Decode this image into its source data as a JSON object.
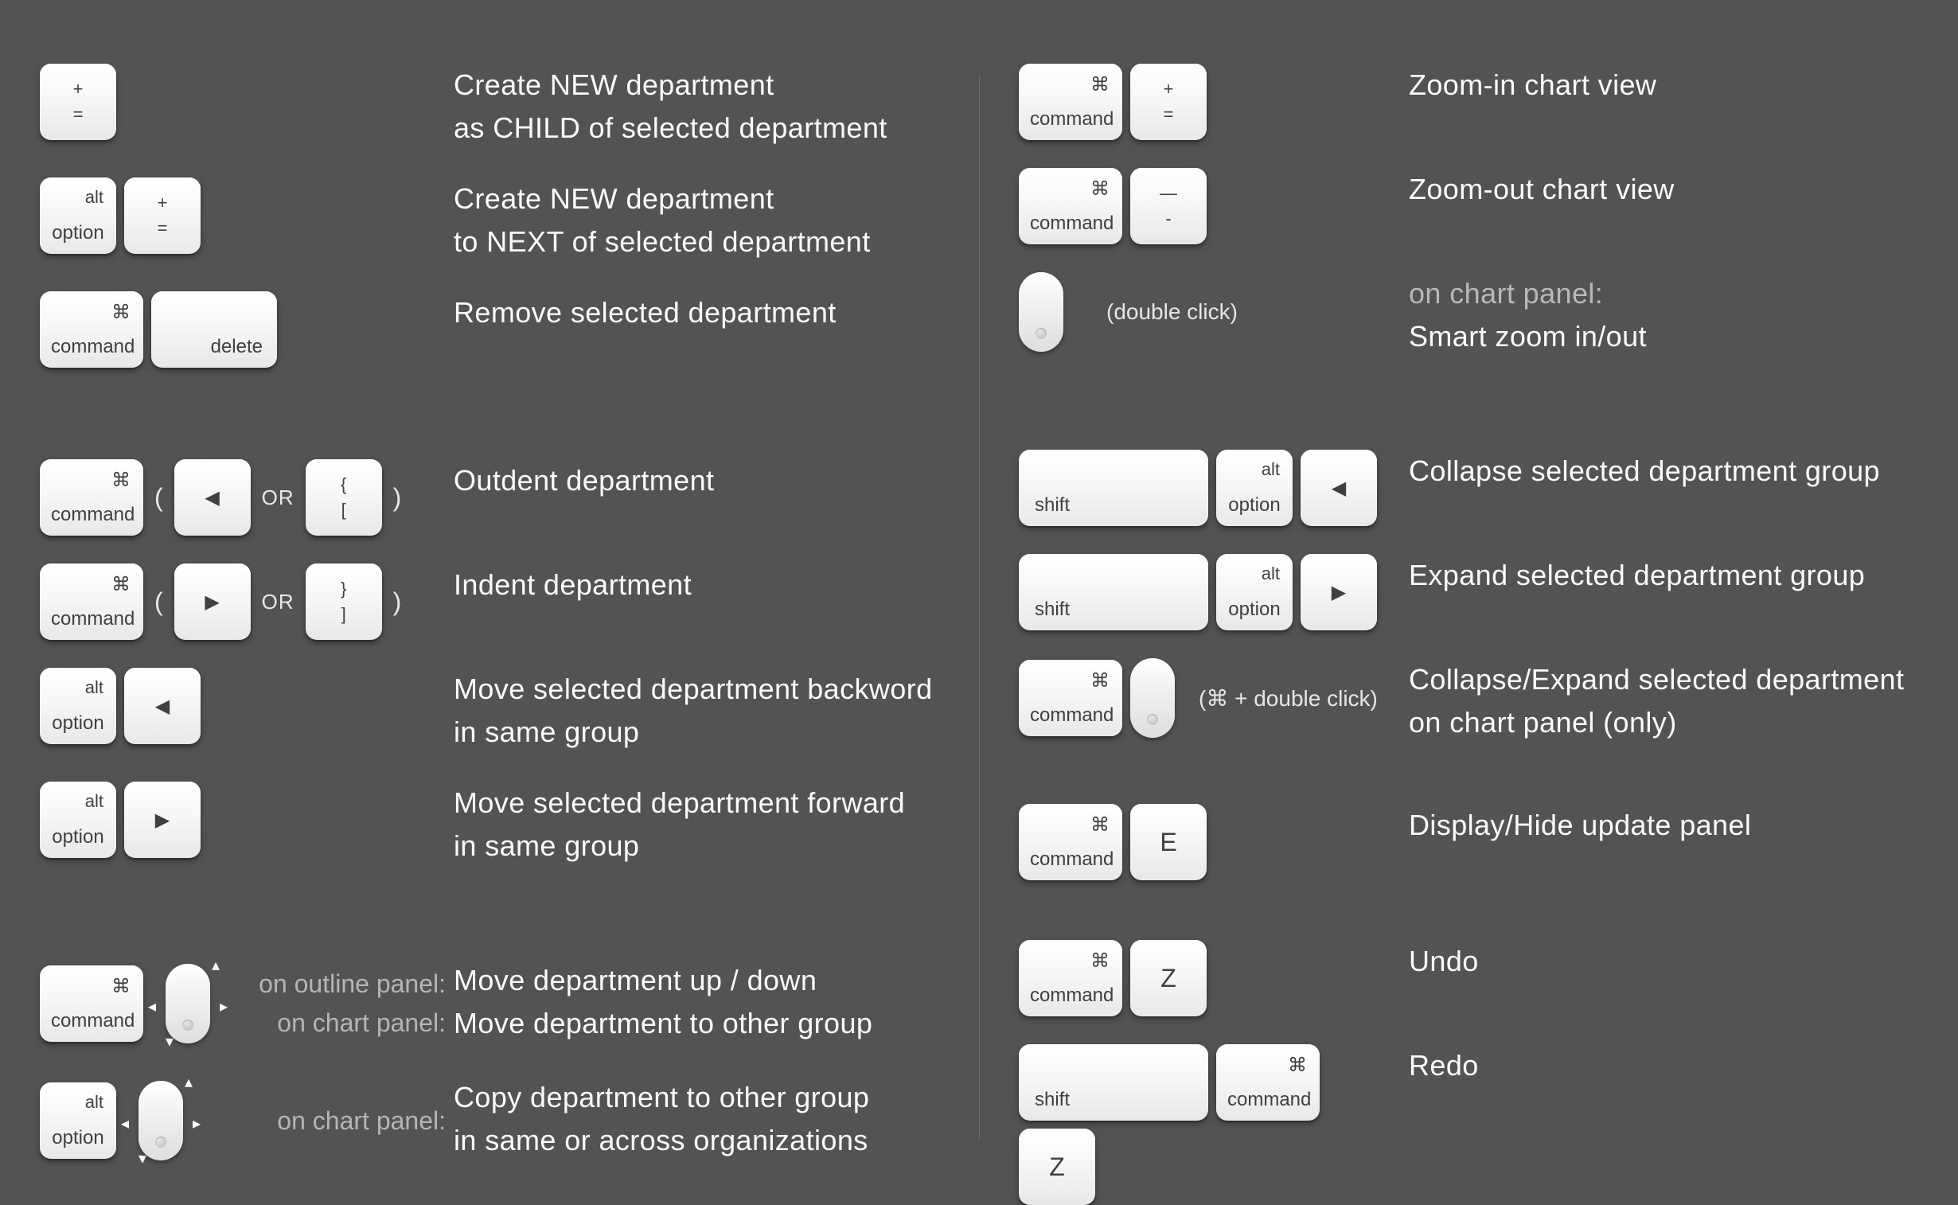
{
  "glyphs": {
    "cmd": "⌘",
    "option_word": "alt",
    "option_label": "option",
    "command_label": "command",
    "delete_label": "delete",
    "shift_label": "shift",
    "plus": "+",
    "equals": "=",
    "minus_top": "—",
    "minus_bottom": "-",
    "left": "◀",
    "right": "▶",
    "brace_open": "{",
    "bracket_open": "[",
    "brace_close": "}",
    "bracket_close": "]",
    "paren_open": "(",
    "paren_close": ")",
    "or": "OR",
    "E": "E",
    "Z": "Z"
  },
  "left": [
    {
      "desc": "Create NEW department\nas CHILD of selected department"
    },
    {
      "desc": "Create NEW department\nto NEXT of selected department"
    },
    {
      "desc": "Remove selected department"
    },
    {
      "desc": "Outdent department"
    },
    {
      "desc": "Indent department"
    },
    {
      "desc": "Move selected department backword\nin same group"
    },
    {
      "desc": "Move selected department forward\nin same group"
    },
    {
      "ctx1": "on outline panel:",
      "ctx2": "on chart panel:",
      "desc1": "Move department up / down",
      "desc2": "Move department to other group"
    },
    {
      "ctx": "on chart panel:",
      "desc": "Copy department to other group\nin same or across organizations"
    }
  ],
  "right": [
    {
      "desc": "Zoom-in chart view"
    },
    {
      "desc": "Zoom-out chart view"
    },
    {
      "note": "(double click)",
      "ctx": "on chart panel:",
      "desc": "Smart zoom in/out"
    },
    {
      "desc": "Collapse selected department group"
    },
    {
      "desc": "Expand selected department group"
    },
    {
      "note": "(⌘ + double click)",
      "desc": "Collapse/Expand selected department\non chart panel (only)"
    },
    {
      "desc": "Display/Hide update panel"
    },
    {
      "desc": "Undo"
    },
    {
      "desc": "Redo"
    }
  ]
}
